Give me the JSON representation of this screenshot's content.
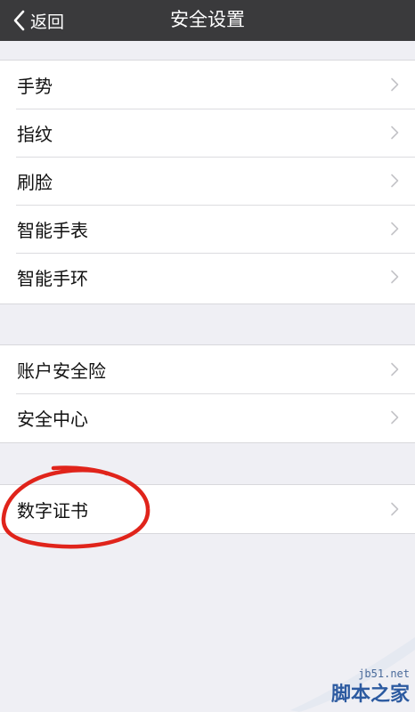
{
  "navbar": {
    "back_label": "返回",
    "title": "安全设置"
  },
  "groups": [
    {
      "items": [
        {
          "label": "手势"
        },
        {
          "label": "指纹"
        },
        {
          "label": "刷脸"
        },
        {
          "label": "智能手表"
        },
        {
          "label": "智能手环"
        }
      ]
    },
    {
      "items": [
        {
          "label": "账户安全险"
        },
        {
          "label": "安全中心"
        }
      ]
    },
    {
      "items": [
        {
          "label": "数字证书"
        }
      ]
    }
  ],
  "annotation": {
    "color": "#e0241b",
    "target": "数字证书"
  },
  "watermark": {
    "url": "jb51.net",
    "name": "脚本之家"
  },
  "colors": {
    "navbar_bg": "#3a3a3c",
    "background": "#efeff4",
    "cell_bg": "#ffffff",
    "chevron": "#c4c4c8"
  },
  "icons": {
    "back": "chevron-left-icon",
    "disclosure": "chevron-right-icon"
  }
}
